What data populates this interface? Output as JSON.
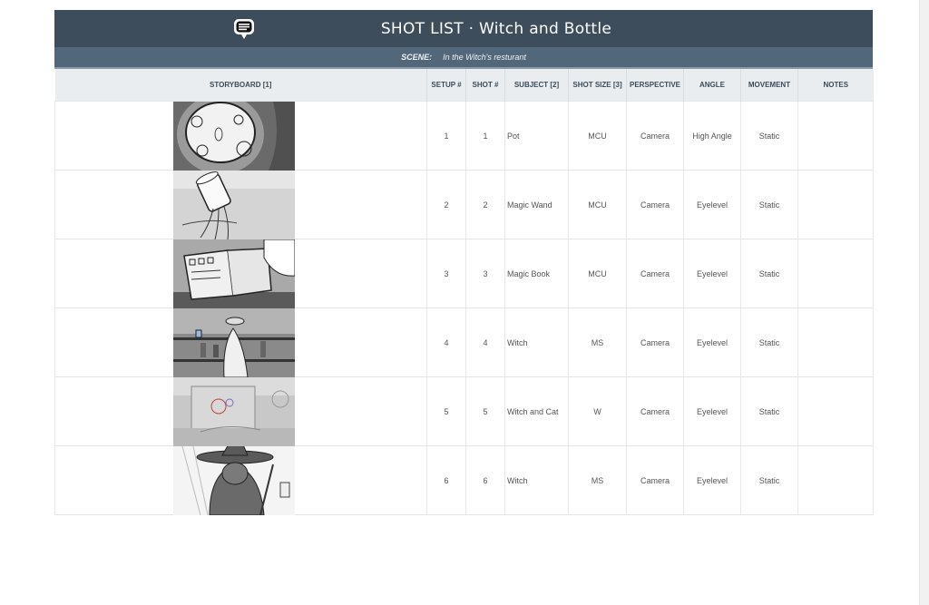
{
  "header": {
    "title": "SHOT LIST · Witch and Bottle",
    "logo_icon": "chat-bubble-icon"
  },
  "scene": {
    "label": "SCENE:",
    "value": "In the Witch's resturant"
  },
  "table": {
    "columns": [
      "STORYBOARD [1]",
      "SETUP #",
      "SHOT #",
      "SUBJECT [2]",
      "SHOT SIZE [3]",
      "PERSPECTIVE",
      "ANGLE",
      "MOVEMENT",
      "NOTES"
    ],
    "rows": [
      {
        "setup": "1",
        "shot": "1",
        "subject": "Pot",
        "size": "MCU",
        "perspective": "Camera",
        "angle": "High Angle",
        "movement": "Static",
        "notes": ""
      },
      {
        "setup": "2",
        "shot": "2",
        "subject": "Magic Wand",
        "size": "MCU",
        "perspective": "Camera",
        "angle": "Eyelevel",
        "movement": "Static",
        "notes": ""
      },
      {
        "setup": "3",
        "shot": "3",
        "subject": "Magic Book",
        "size": "MCU",
        "perspective": "Camera",
        "angle": "Eyelevel",
        "movement": "Static",
        "notes": ""
      },
      {
        "setup": "4",
        "shot": "4",
        "subject": "Witch",
        "size": "MS",
        "perspective": "Camera",
        "angle": "Eyelevel",
        "movement": "Static",
        "notes": ""
      },
      {
        "setup": "5",
        "shot": "5",
        "subject": "Witch and Cat",
        "size": "W",
        "perspective": "Camera",
        "angle": "Eyelevel",
        "movement": "Static",
        "notes": ""
      },
      {
        "setup": "6",
        "shot": "6",
        "subject": "Witch",
        "size": "MS",
        "perspective": "Camera",
        "angle": "Eyelevel",
        "movement": "Static",
        "notes": ""
      }
    ]
  },
  "colors": {
    "title_bar": "#3e4d5b",
    "scene_bar": "#53677a",
    "header_row": "#e9edf0"
  }
}
